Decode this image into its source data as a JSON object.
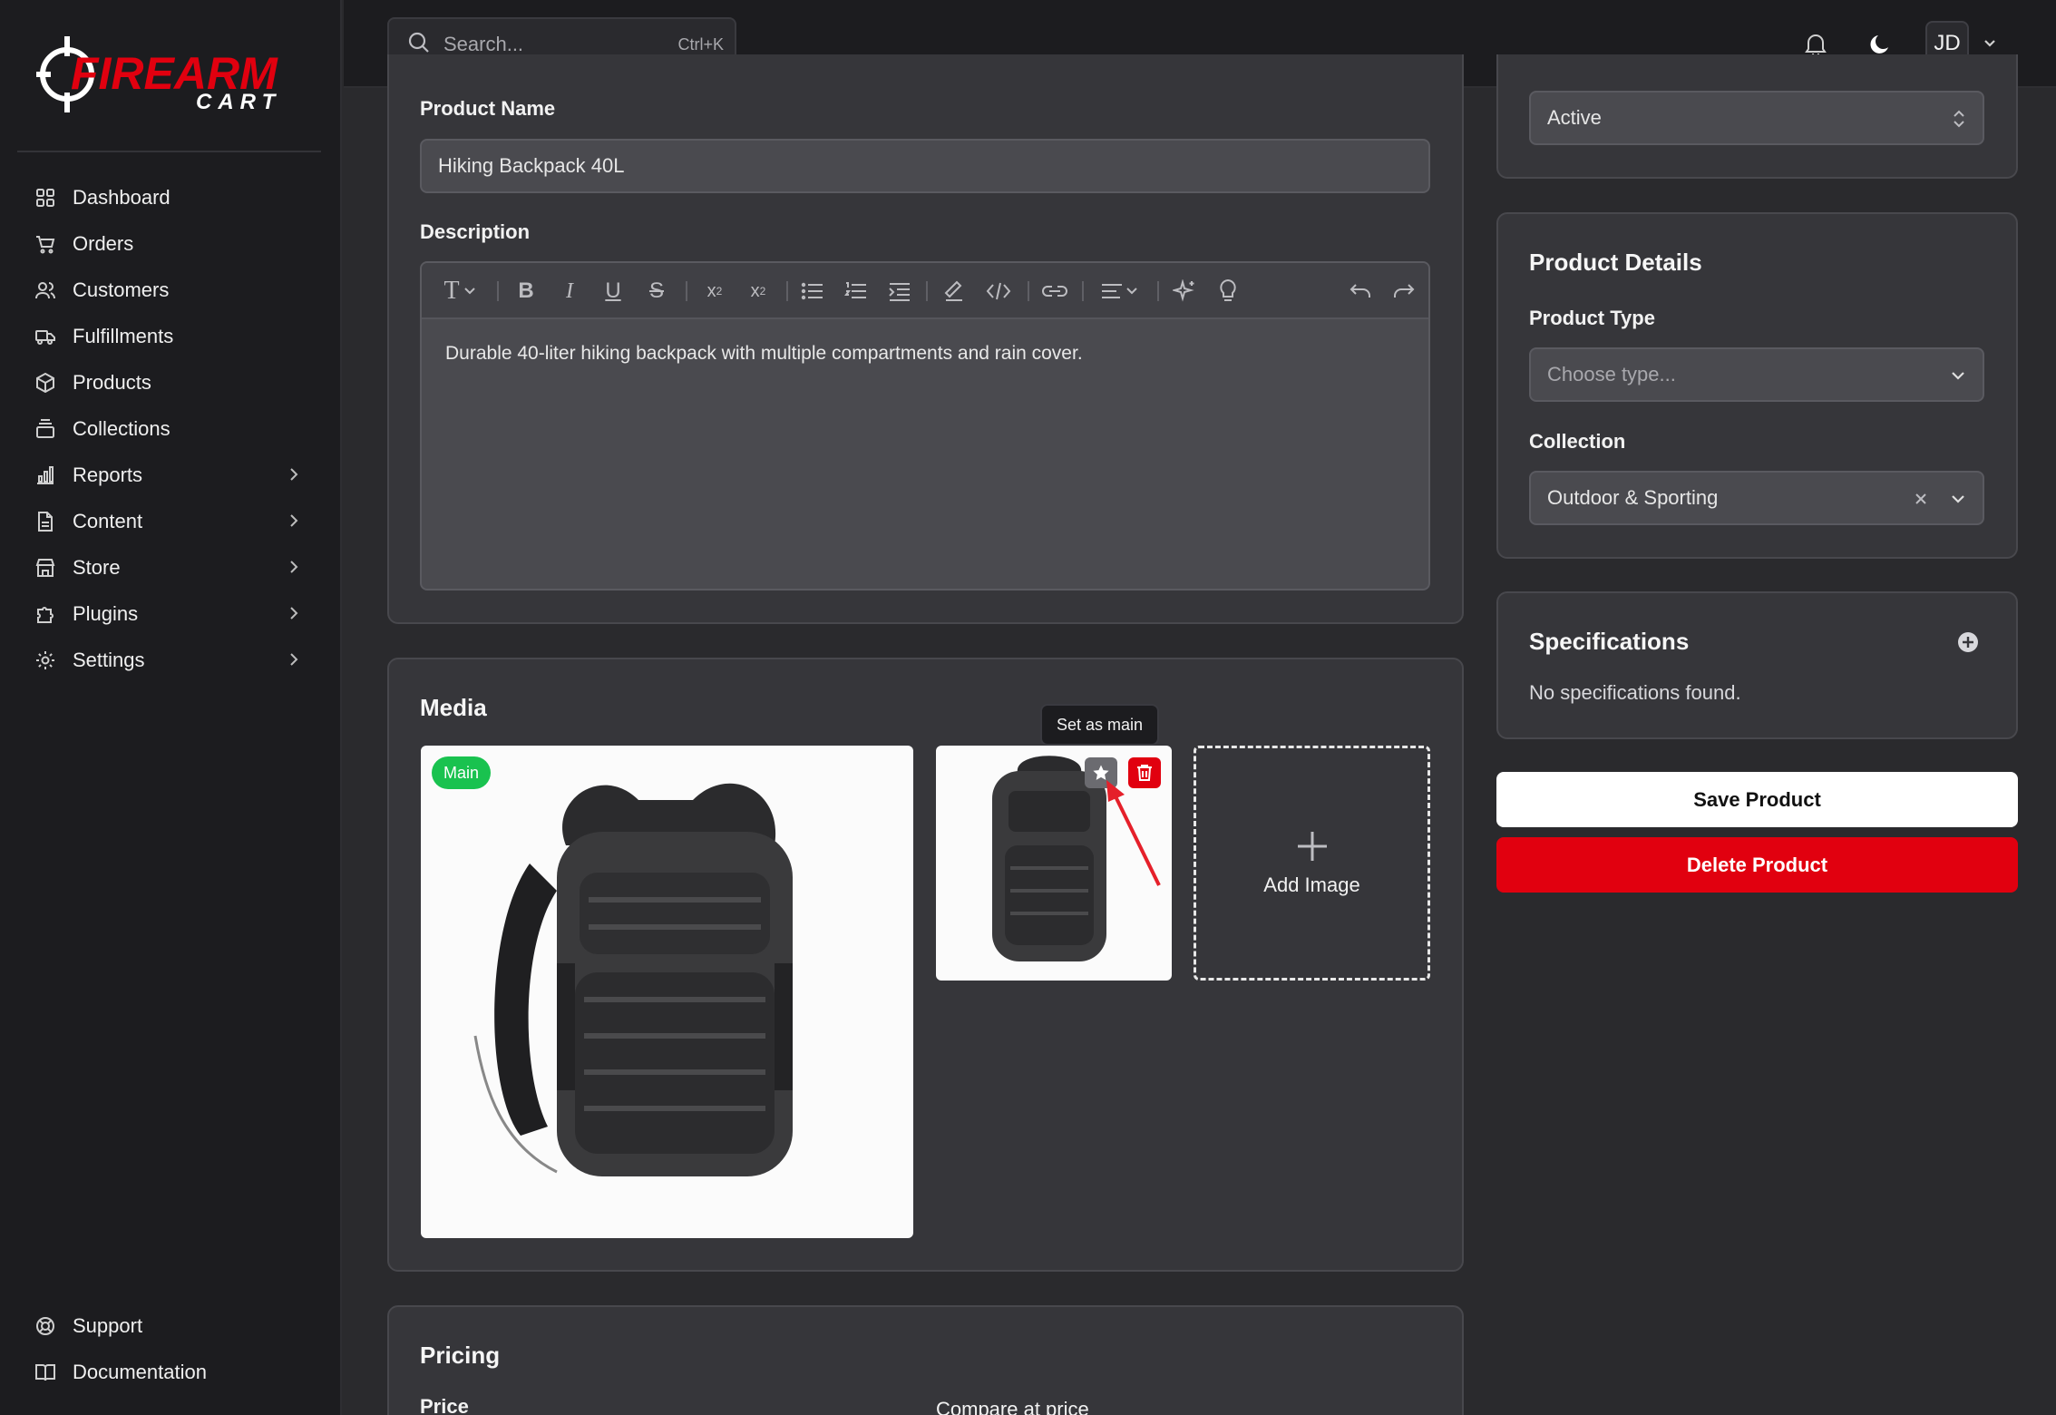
{
  "brand": {
    "logo_line1": "FIREARM",
    "logo_line2": "CART",
    "accent": "#e1000f"
  },
  "sidebar": {
    "items": [
      {
        "label": "Dashboard",
        "icon": "dashboard-icon"
      },
      {
        "label": "Orders",
        "icon": "cart-icon"
      },
      {
        "label": "Customers",
        "icon": "users-icon"
      },
      {
        "label": "Fulfillments",
        "icon": "truck-icon"
      },
      {
        "label": "Products",
        "icon": "box-icon"
      },
      {
        "label": "Collections",
        "icon": "collection-icon"
      },
      {
        "label": "Reports",
        "icon": "chart-icon"
      },
      {
        "label": "Content",
        "icon": "document-icon"
      },
      {
        "label": "Store",
        "icon": "store-icon"
      },
      {
        "label": "Plugins",
        "icon": "puzzle-icon"
      },
      {
        "label": "Settings",
        "icon": "gear-icon"
      }
    ],
    "bottom_items": [
      {
        "label": "Support",
        "icon": "lifebuoy-icon"
      },
      {
        "label": "Documentation",
        "icon": "book-icon"
      }
    ]
  },
  "topbar": {
    "search_placeholder": "Search...",
    "search_shortcut": "Ctrl+K",
    "avatar_initials": "JD"
  },
  "main": {
    "product_name_label": "Product Name",
    "product_name_value": "Hiking Backpack 40L",
    "description_label": "Description",
    "description_value": "Durable 40-liter hiking backpack with multiple compartments and rain cover.",
    "media": {
      "title": "Media",
      "main_badge": "Main",
      "tooltip": "Set as main",
      "add_image_label": "Add Image"
    },
    "pricing": {
      "title": "Pricing",
      "price_label": "Price",
      "compare_label": "Compare at price"
    }
  },
  "right": {
    "status_value": "Active",
    "details": {
      "title": "Product Details",
      "type_label": "Product Type",
      "type_placeholder": "Choose type...",
      "collection_label": "Collection",
      "collection_value": "Outdoor & Sporting"
    },
    "specs": {
      "title": "Specifications",
      "empty": "No specifications found."
    },
    "save_label": "Save Product",
    "delete_label": "Delete Product"
  }
}
